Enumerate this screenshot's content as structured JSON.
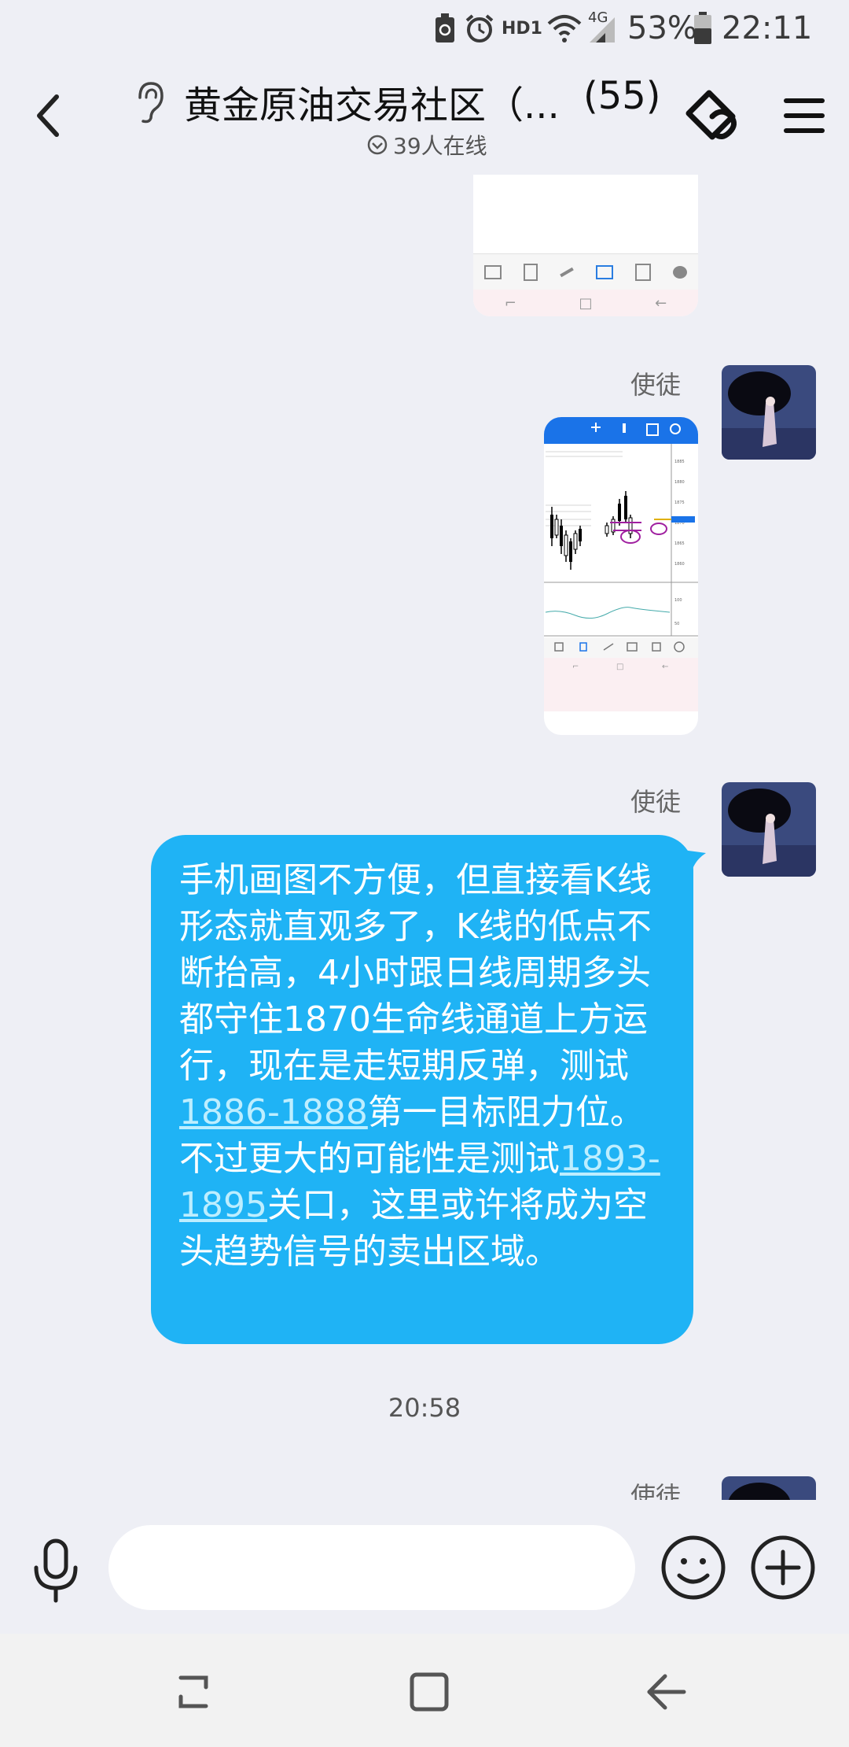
{
  "status_bar": {
    "hd_label": "HD1",
    "network_label": "4G",
    "battery_percent": "53%",
    "battery_level": 0.53,
    "time": "22:11",
    "icons": [
      "recycle-icon",
      "alarm-icon",
      "wifi-icon",
      "signal-icon",
      "battery-icon"
    ]
  },
  "header": {
    "title": "黄金原油交易社区（...",
    "member_count": "(55)",
    "online_status": "39人在线",
    "icons": [
      "back-icon",
      "ear-icon",
      "voice-call-icon",
      "menu-icon"
    ]
  },
  "messages": [
    {
      "type": "image",
      "sender": "",
      "description": "partial-trading-screenshot"
    },
    {
      "type": "image",
      "sender": "使徒"
    },
    {
      "type": "text",
      "sender": "使徒",
      "segments": [
        {
          "text": "手机画图不方便，但直接看K线形态就直观多了，K线的低点不断抬高，4小时跟日线周期多头都守住1870生命线通道上方运行，现在是走短期反弹，测试",
          "link": false
        },
        {
          "text": "1886-1888",
          "link": true
        },
        {
          "text": "第一目标阻力位。不过更大的可能性是测试",
          "link": false
        },
        {
          "text": "1893-1895",
          "link": true
        },
        {
          "text": "关口，这里或许将成为空头趋势信号的卖出区域。",
          "link": false
        }
      ]
    },
    {
      "type": "timestamp",
      "text": "20:58"
    },
    {
      "type": "image",
      "sender": "使徒",
      "partial": true
    }
  ],
  "input_bar": {
    "placeholder": "",
    "value": "",
    "icons": [
      "mic-icon",
      "emoji-icon",
      "plus-icon"
    ]
  },
  "colors": {
    "bubble": "#1fb3f5",
    "background": "#eeeff5",
    "link": "#bdeeff",
    "chart_header": "#1a73e8"
  }
}
